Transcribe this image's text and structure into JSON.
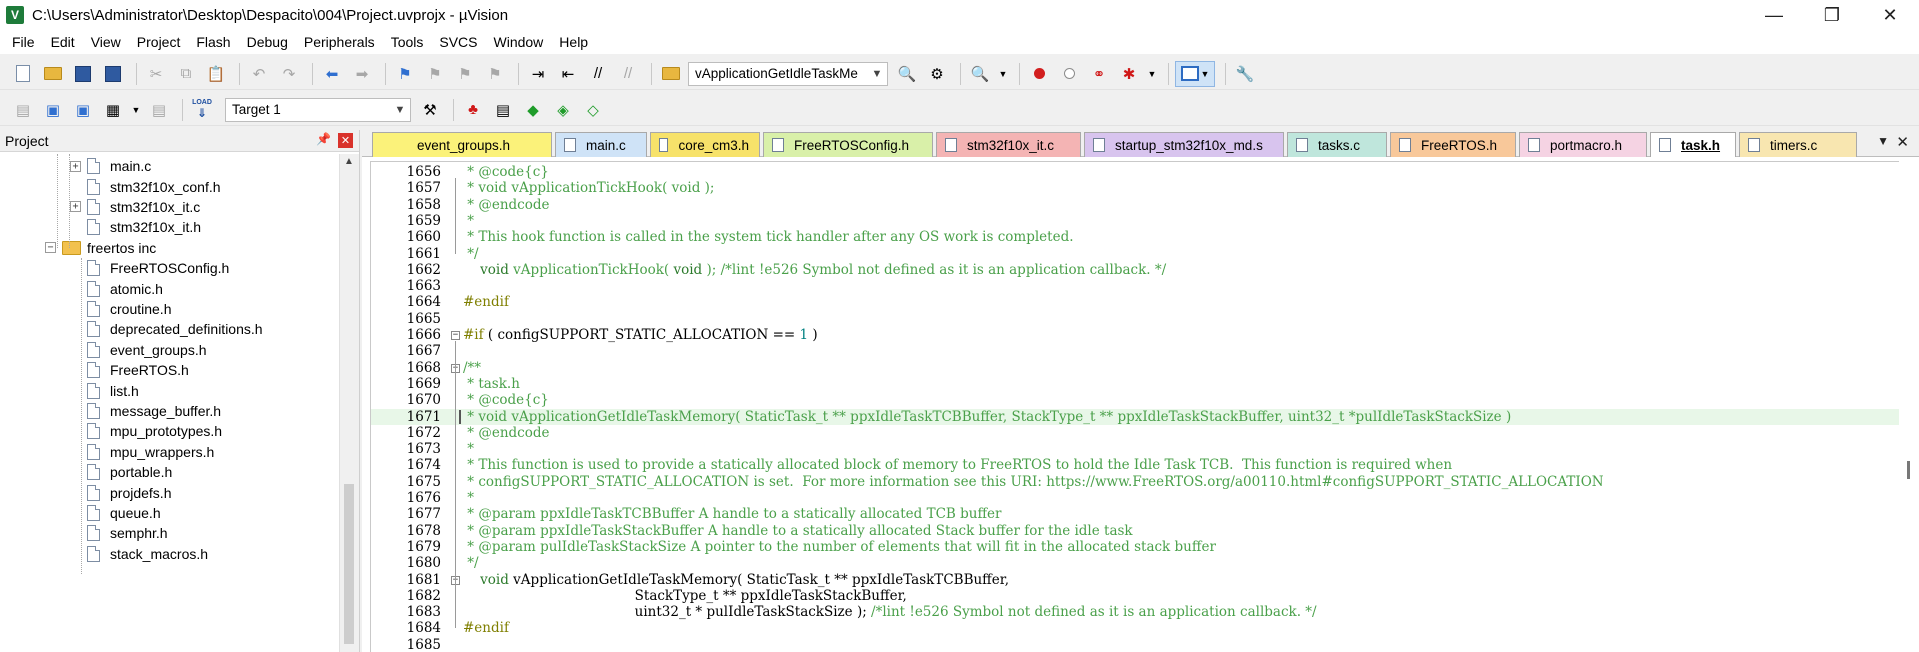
{
  "window": {
    "title": "C:\\Users\\Administrator\\Desktop\\Despacito\\004\\Project.uvprojx - µVision",
    "app_icon": "V",
    "controls": {
      "minimize": "—",
      "maximize": "❐",
      "close": "✕"
    }
  },
  "menu": [
    "File",
    "Edit",
    "View",
    "Project",
    "Flash",
    "Debug",
    "Peripherals",
    "Tools",
    "SVCS",
    "Window",
    "Help"
  ],
  "toolbar": {
    "function_combo": "vApplicationGetIdleTaskMe",
    "target_combo": "Target 1",
    "load_label": "LOAD"
  },
  "project_panel": {
    "title": "Project",
    "pin_icon": "pin-icon",
    "items": [
      {
        "label": "main.c",
        "kind": "file",
        "expander": "+"
      },
      {
        "label": "stm32f10x_conf.h",
        "kind": "file",
        "expander": ""
      },
      {
        "label": "stm32f10x_it.c",
        "kind": "file",
        "expander": "+"
      },
      {
        "label": "stm32f10x_it.h",
        "kind": "file",
        "expander": ""
      },
      {
        "label": "freertos inc",
        "kind": "folder",
        "expander": "−"
      },
      {
        "label": "FreeRTOSConfig.h",
        "kind": "file",
        "expander": ""
      },
      {
        "label": "atomic.h",
        "kind": "file",
        "expander": ""
      },
      {
        "label": "croutine.h",
        "kind": "file",
        "expander": ""
      },
      {
        "label": "deprecated_definitions.h",
        "kind": "file",
        "expander": ""
      },
      {
        "label": "event_groups.h",
        "kind": "file",
        "expander": ""
      },
      {
        "label": "FreeRTOS.h",
        "kind": "file",
        "expander": ""
      },
      {
        "label": "list.h",
        "kind": "file",
        "expander": ""
      },
      {
        "label": "message_buffer.h",
        "kind": "file",
        "expander": ""
      },
      {
        "label": "mpu_prototypes.h",
        "kind": "file",
        "expander": ""
      },
      {
        "label": "mpu_wrappers.h",
        "kind": "file",
        "expander": ""
      },
      {
        "label": "portable.h",
        "kind": "file",
        "expander": ""
      },
      {
        "label": "projdefs.h",
        "kind": "file",
        "expander": ""
      },
      {
        "label": "queue.h",
        "kind": "file",
        "expander": ""
      },
      {
        "label": "semphr.h",
        "kind": "file",
        "expander": ""
      },
      {
        "label": "stack_macros.h",
        "kind": "file",
        "expander": ""
      }
    ]
  },
  "tabs": [
    {
      "label": "event_groups.h",
      "color": "#fbf27a",
      "active": false
    },
    {
      "label": "main.c",
      "color": "#cfe3f7",
      "active": false
    },
    {
      "label": "core_cm3.h",
      "color": "#f7e26a",
      "active": false
    },
    {
      "label": "FreeRTOSConfig.h",
      "color": "#d9f0a9",
      "active": false
    },
    {
      "label": "stm32f10x_it.c",
      "color": "#f4b4b4",
      "active": false
    },
    {
      "label": "startup_stm32f10x_md.s",
      "color": "#d8c4ee",
      "active": false
    },
    {
      "label": "tasks.c",
      "color": "#bfe6dc",
      "active": false
    },
    {
      "label": "FreeRTOS.h",
      "color": "#f8c89a",
      "active": false
    },
    {
      "label": "portmacro.h",
      "color": "#f5d3e3",
      "active": false
    },
    {
      "label": "task.h",
      "color": "#cfe3f7",
      "active": true
    },
    {
      "label": "timers.c",
      "color": "#f8e6b0",
      "active": false
    }
  ],
  "code": [
    {
      "n": "1656",
      "segs": [
        [
          "cmt",
          " * @code{c}"
        ]
      ]
    },
    {
      "n": "1657",
      "segs": [
        [
          "cmt",
          " * void vApplicationTickHook( void );"
        ]
      ]
    },
    {
      "n": "1658",
      "segs": [
        [
          "cmt",
          " * @endcode"
        ]
      ]
    },
    {
      "n": "1659",
      "segs": [
        [
          "cmt",
          " *"
        ]
      ]
    },
    {
      "n": "1660",
      "segs": [
        [
          "cmt",
          " * This hook function is called in the system tick handler after any OS work is completed."
        ]
      ]
    },
    {
      "n": "1661",
      "segs": [
        [
          "cmt",
          " */"
        ]
      ]
    },
    {
      "n": "1662",
      "segs": [
        [
          "plain",
          "    "
        ],
        [
          "kw",
          "void"
        ],
        [
          "cmt",
          " vApplicationTickHook( "
        ],
        [
          "kw",
          "void"
        ],
        [
          "cmt",
          " ); /*lint !e526 Symbol not defined as it is an application callback. */"
        ]
      ]
    },
    {
      "n": "1663",
      "segs": [
        [
          "plain",
          ""
        ]
      ]
    },
    {
      "n": "1664",
      "segs": [
        [
          "pp",
          "#endif"
        ]
      ]
    },
    {
      "n": "1665",
      "segs": [
        [
          "plain",
          ""
        ]
      ]
    },
    {
      "n": "1666",
      "segs": [
        [
          "pp",
          "#if"
        ],
        [
          "plain",
          " ( configSUPPORT_STATIC_ALLOCATION == "
        ],
        [
          "num",
          "1"
        ],
        [
          "plain",
          " )"
        ]
      ]
    },
    {
      "n": "1667",
      "segs": [
        [
          "plain",
          ""
        ]
      ]
    },
    {
      "n": "1668",
      "segs": [
        [
          "cmt",
          "/**"
        ]
      ]
    },
    {
      "n": "1669",
      "segs": [
        [
          "cmt",
          " * task.h"
        ]
      ]
    },
    {
      "n": "1670",
      "segs": [
        [
          "cmt",
          " * @code{c}"
        ]
      ]
    },
    {
      "n": "1671",
      "segs": [
        [
          "cmt",
          " * void vApplicationGetIdleTaskMemory( StaticTask_t ** ppxIdleTaskTCBBuffer, StackType_t ** ppxIdleTaskStackBuffer, uint32_t *pulIdleTaskStackSize )"
        ]
      ]
    },
    {
      "n": "1672",
      "segs": [
        [
          "cmt",
          " * @endcode"
        ]
      ]
    },
    {
      "n": "1673",
      "segs": [
        [
          "cmt",
          " *"
        ]
      ]
    },
    {
      "n": "1674",
      "segs": [
        [
          "cmt",
          " * This function is used to provide a statically allocated block of memory to FreeRTOS to hold the Idle Task TCB.  This function is required when"
        ]
      ]
    },
    {
      "n": "1675",
      "segs": [
        [
          "cmt",
          " * configSUPPORT_STATIC_ALLOCATION is set.  For more information see this URI: https://www.FreeRTOS.org/a00110.html#configSUPPORT_STATIC_ALLOCATION"
        ]
      ]
    },
    {
      "n": "1676",
      "segs": [
        [
          "cmt",
          " *"
        ]
      ]
    },
    {
      "n": "1677",
      "segs": [
        [
          "cmt",
          " * @param ppxIdleTaskTCBBuffer A handle to a statically allocated TCB buffer"
        ]
      ]
    },
    {
      "n": "1678",
      "segs": [
        [
          "cmt",
          " * @param ppxIdleTaskStackBuffer A handle to a statically allocated Stack buffer for the idle task"
        ]
      ]
    },
    {
      "n": "1679",
      "segs": [
        [
          "cmt",
          " * @param pulIdleTaskStackSize A pointer to the number of elements that will fit in the allocated stack buffer"
        ]
      ]
    },
    {
      "n": "1680",
      "segs": [
        [
          "cmt",
          " */"
        ]
      ]
    },
    {
      "n": "1681",
      "segs": [
        [
          "plain",
          "    "
        ],
        [
          "kw",
          "void"
        ],
        [
          "plain",
          " vApplicationGetIdleTaskMemory( StaticTask_t ** ppxIdleTaskTCBBuffer,"
        ]
      ]
    },
    {
      "n": "1682",
      "segs": [
        [
          "plain",
          "                                        StackType_t ** ppxIdleTaskStackBuffer,"
        ]
      ]
    },
    {
      "n": "1683",
      "segs": [
        [
          "plain",
          "                                        uint32_t * pulIdleTaskStackSize ); "
        ],
        [
          "cmt",
          "/*lint !e526 Symbol not defined as it is an application callback. */"
        ]
      ]
    },
    {
      "n": "1684",
      "segs": [
        [
          "pp",
          "#endif"
        ]
      ]
    },
    {
      "n": "1685",
      "segs": [
        [
          "plain",
          ""
        ]
      ]
    }
  ]
}
